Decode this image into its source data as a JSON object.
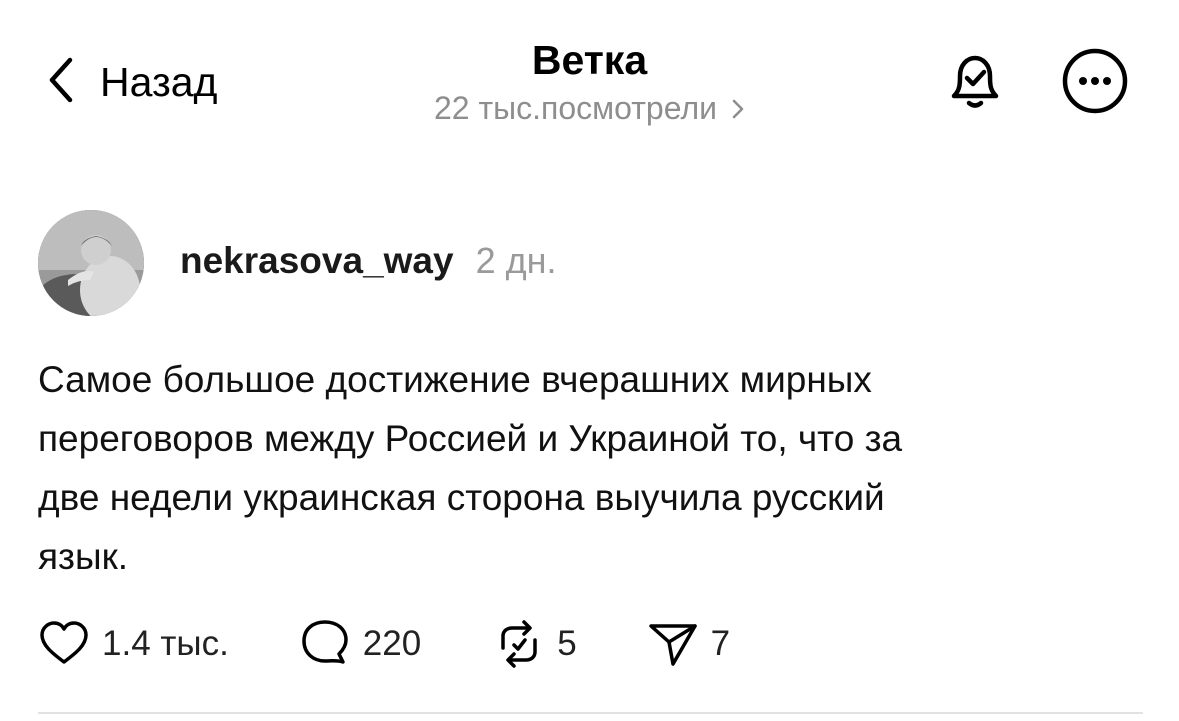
{
  "header": {
    "back_label": "Назад",
    "title": "Ветка",
    "views": "22 тыс.посмотрели",
    "icons": {
      "back": "chevron-left-icon",
      "views_chevron": "chevron-right-icon",
      "bell": "bell-check-icon",
      "more": "more-icon"
    }
  },
  "post": {
    "username": "nekrasova_way",
    "time": "2 дн.",
    "avatar": "avatar",
    "lines": [
      "Самое большое достижение вчерашних  мирных",
      "переговоров между Россией и Украиной то, что за",
      "две недели украинская сторона выучила русский",
      "язык."
    ],
    "actions": {
      "likes": "1.4 тыс.",
      "comments": "220",
      "reposts": "5",
      "shares": "7"
    }
  }
}
